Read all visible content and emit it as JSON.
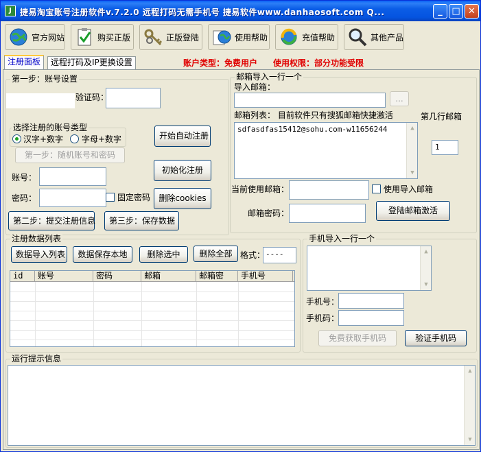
{
  "window": {
    "title": "捷易淘宝账号注册软件v.7.2.0   远程打码无需手机号 捷易软件www.danhaosoft.com Q..."
  },
  "toolbar": {
    "items": [
      {
        "label": "官方网站",
        "icon": "globe-icon"
      },
      {
        "label": "购买正版",
        "icon": "clipboard-check-icon"
      },
      {
        "label": "正版登陆",
        "icon": "keys-icon"
      },
      {
        "label": "使用帮助",
        "icon": "help-globe-icon"
      },
      {
        "label": "充值帮助",
        "icon": "refresh-globe-icon"
      },
      {
        "label": "其他产品",
        "icon": "magnifier-icon"
      }
    ]
  },
  "tabs": [
    {
      "label": "注册面板",
      "active": true
    },
    {
      "label": "远程打码及IP更换设置",
      "active": false
    }
  ],
  "status": {
    "account_type": "账户类型：免费用户",
    "permission": "使用权限：部分功能受限"
  },
  "step1": {
    "legend": "第一步：账号设置",
    "captcha_label": "验证码：",
    "captcha_value": "",
    "type_group_label": "选择注册的账号类型",
    "radio_hanzi": "汉字+数字",
    "radio_letters": "字母+数字",
    "random_button": "第一步：随机账号和密码",
    "account_label": "账号：",
    "password_label": "密码：",
    "fixed_password_label": "固定密码",
    "start_button": "开始自动注册",
    "init_button": "初始化注册",
    "delete_cookies_button": "删除cookies",
    "submit_button": "第二步：提交注册信息",
    "save_button": "第三步：保存数据"
  },
  "mail": {
    "legend": "邮箱导入一行一个",
    "import_label": "导入邮箱：",
    "browse_button": "...",
    "list_label": "邮箱列表：  目前软件只有搜狐邮箱快捷激活",
    "list_content": "sdfasdfas15412@sohu.com-w11656244",
    "row_label": "第几行邮箱",
    "row_value": "1",
    "current_label": "当前使用邮箱：",
    "use_import_label": "使用导入邮箱",
    "password_label": "邮箱密码：",
    "login_button": "登陆邮箱激活"
  },
  "datalist": {
    "legend": "注册数据列表",
    "import_button": "数据导入列表",
    "save_local_button": "数据保存本地",
    "delete_selected_button": "删除选中",
    "delete_all_button": "删除全部",
    "format_label": "格式：",
    "format_value": "----",
    "columns": [
      "id",
      "账号",
      "密码",
      "邮箱",
      "邮箱密",
      "手机号"
    ]
  },
  "phone": {
    "legend": "手机导入一行一个",
    "phone_label": "手机号：",
    "code_label": "手机码：",
    "free_button": "免费获取手机码",
    "verify_button": "验证手机码"
  },
  "log": {
    "legend": "运行提示信息"
  },
  "colors": {
    "titlebar": "#0554e0",
    "face": "#ece9d8",
    "status_red": "#e00000"
  }
}
